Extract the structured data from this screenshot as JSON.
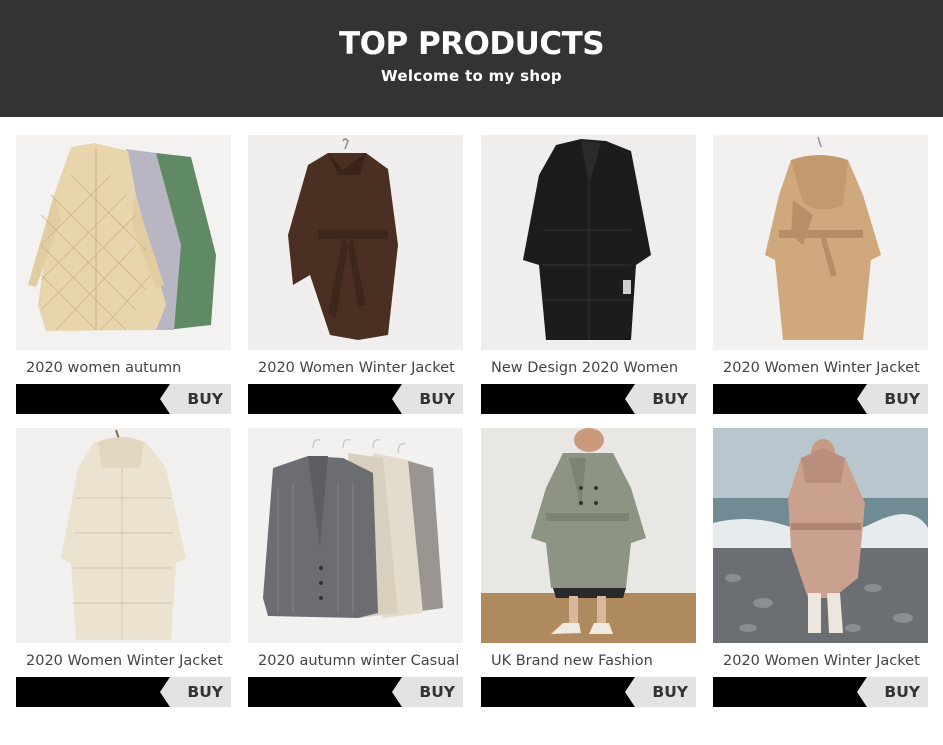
{
  "header": {
    "title": "TOP PRODUCTS",
    "subtitle": "Welcome to my shop",
    "background": "#333333"
  },
  "products": [
    {
      "name": "2020 women autumn",
      "buy_label": "BUY",
      "image": "quilted-coats-trio"
    },
    {
      "name": "2020 Women Winter Jacket",
      "buy_label": "BUY",
      "image": "brown-belted-hooded-coat"
    },
    {
      "name": "New Design 2020 Women",
      "buy_label": "BUY",
      "image": "black-puffer-coat"
    },
    {
      "name": "2020 Women Winter Jacket",
      "buy_label": "BUY",
      "image": "camel-scarf-coat"
    },
    {
      "name": "2020 Women Winter Jacket",
      "buy_label": "BUY",
      "image": "cream-hooded-puffer"
    },
    {
      "name": "2020 autumn winter Casual",
      "buy_label": "BUY",
      "image": "knit-cardigans-on-hangers"
    },
    {
      "name": "UK Brand new Fashion",
      "buy_label": "BUY",
      "image": "sage-trench-coat-model"
    },
    {
      "name": "2020 Women Winter Jacket",
      "buy_label": "BUY",
      "image": "pink-puffer-beach-model"
    }
  ]
}
